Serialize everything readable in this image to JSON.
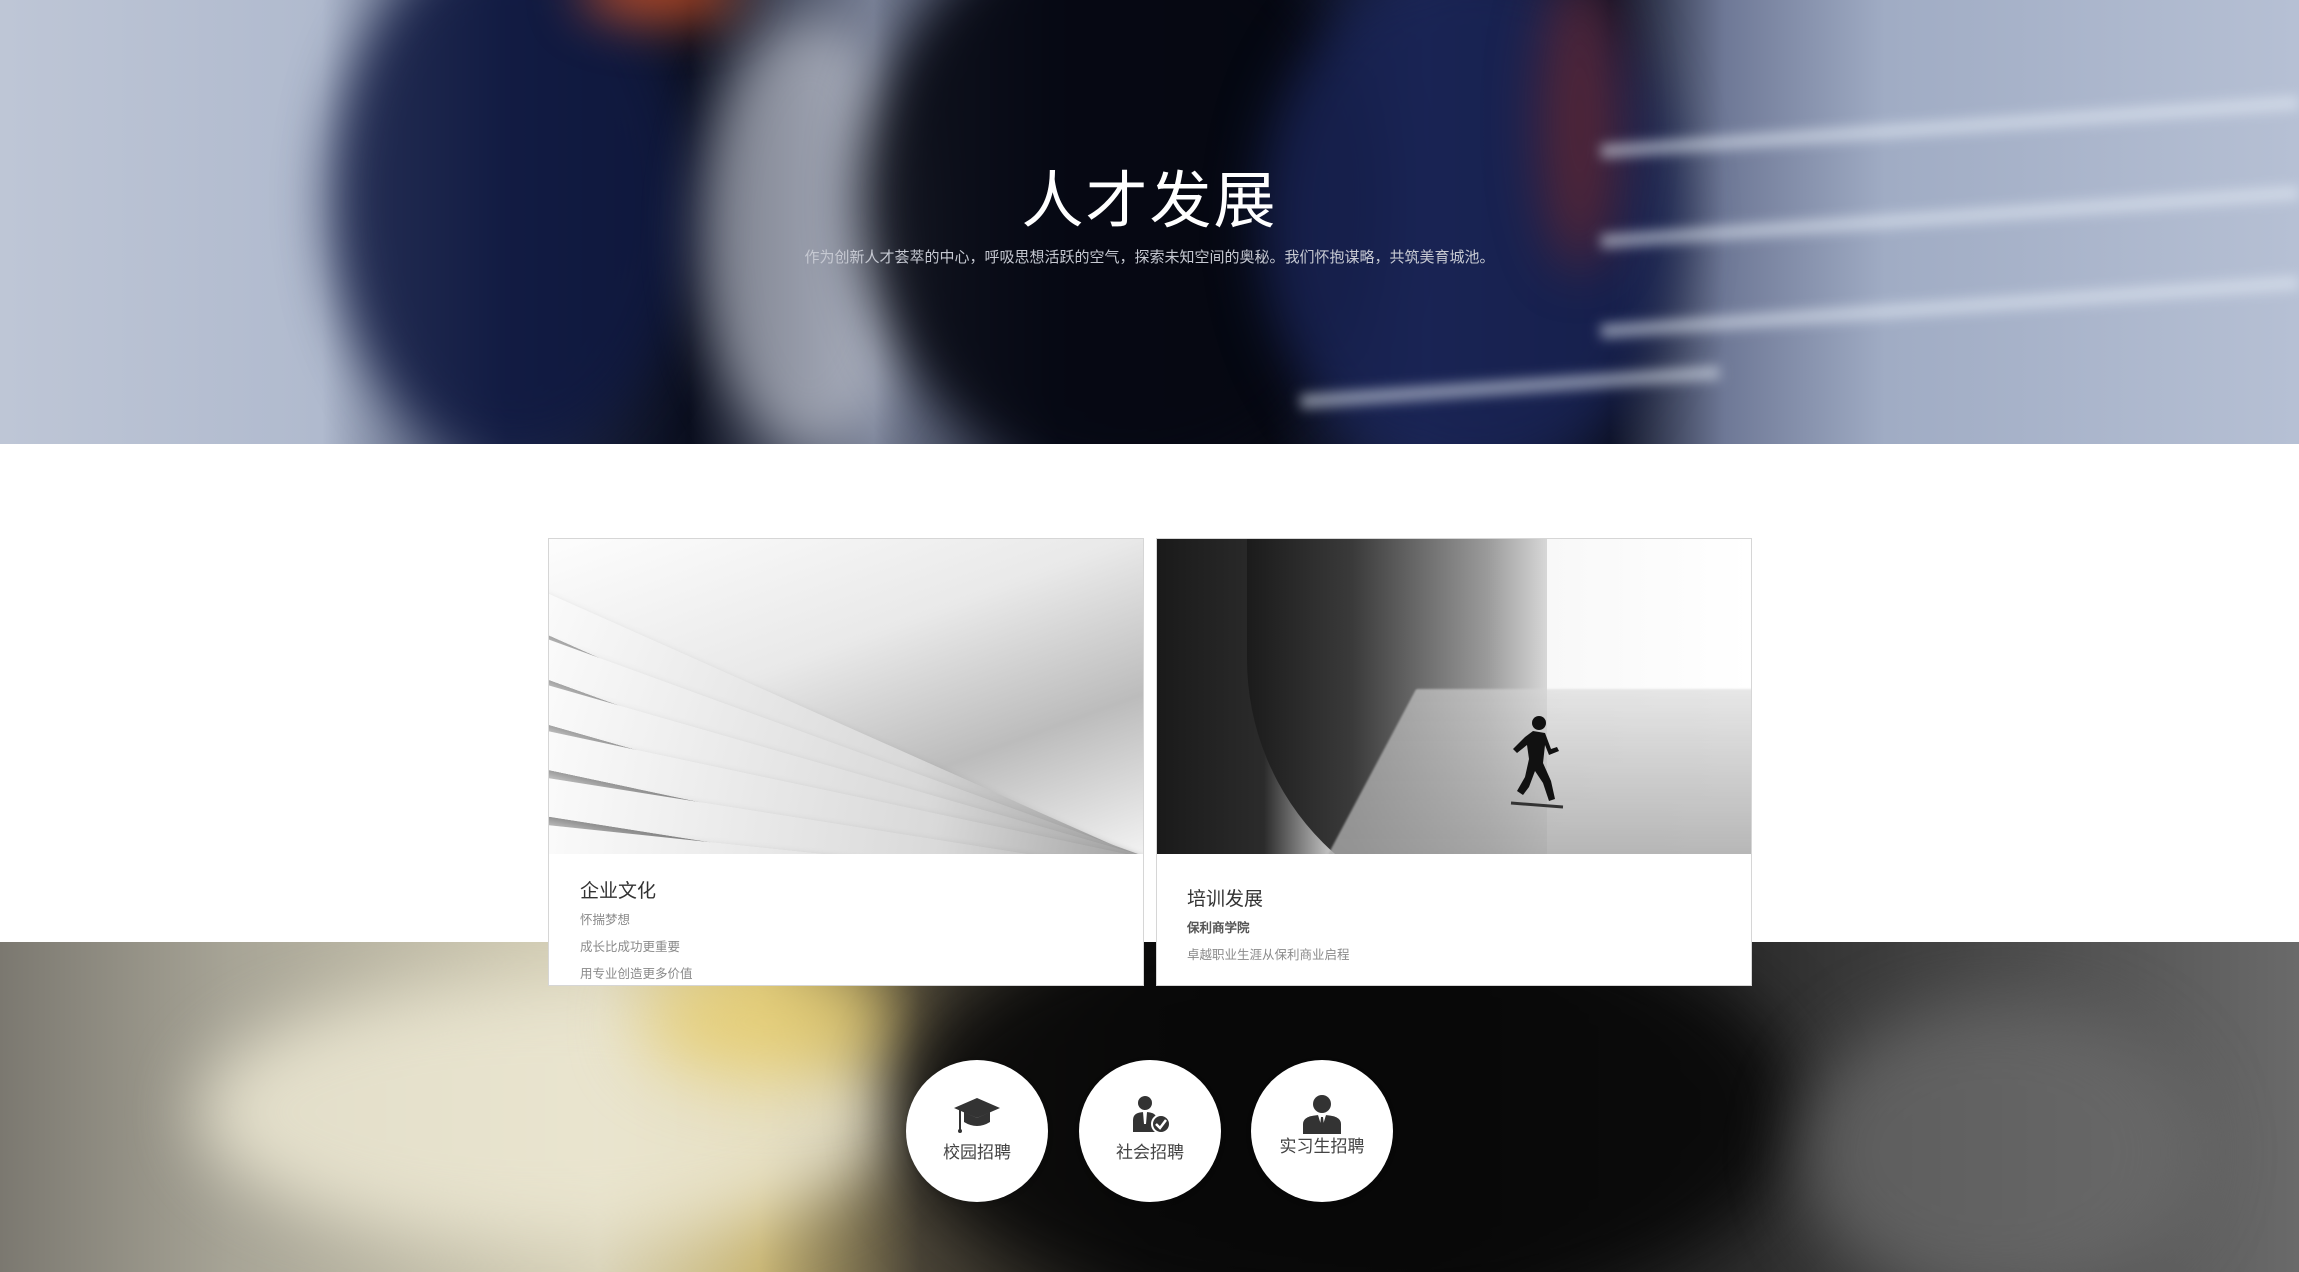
{
  "hero": {
    "title": "人才发展",
    "subtitle": "作为创新人才荟萃的中心，呼吸思想活跃的空气，探索未知空间的奥秘。我们怀抱谋略，共筑美育城池。"
  },
  "cards": [
    {
      "title": "企业文化",
      "lines": [
        "怀揣梦想",
        "成长比成功更重要",
        "用专业创造更多价值"
      ],
      "image": "blurred-book-pages"
    },
    {
      "title": "培训发展",
      "lines": [
        "保利商学院",
        "卓越职业生涯从保利商业启程"
      ],
      "image": "runner-on-slope"
    }
  ],
  "recruit": [
    {
      "label": "校园招聘",
      "icon": "graduation-cap-icon"
    },
    {
      "label": "社会招聘",
      "icon": "person-check-icon"
    },
    {
      "label": "实习生招聘",
      "icon": "person-suit-icon"
    }
  ],
  "colors": {
    "text_dark": "#333333",
    "text_muted": "#8a8a8a",
    "circle_bg": "#ffffff"
  }
}
